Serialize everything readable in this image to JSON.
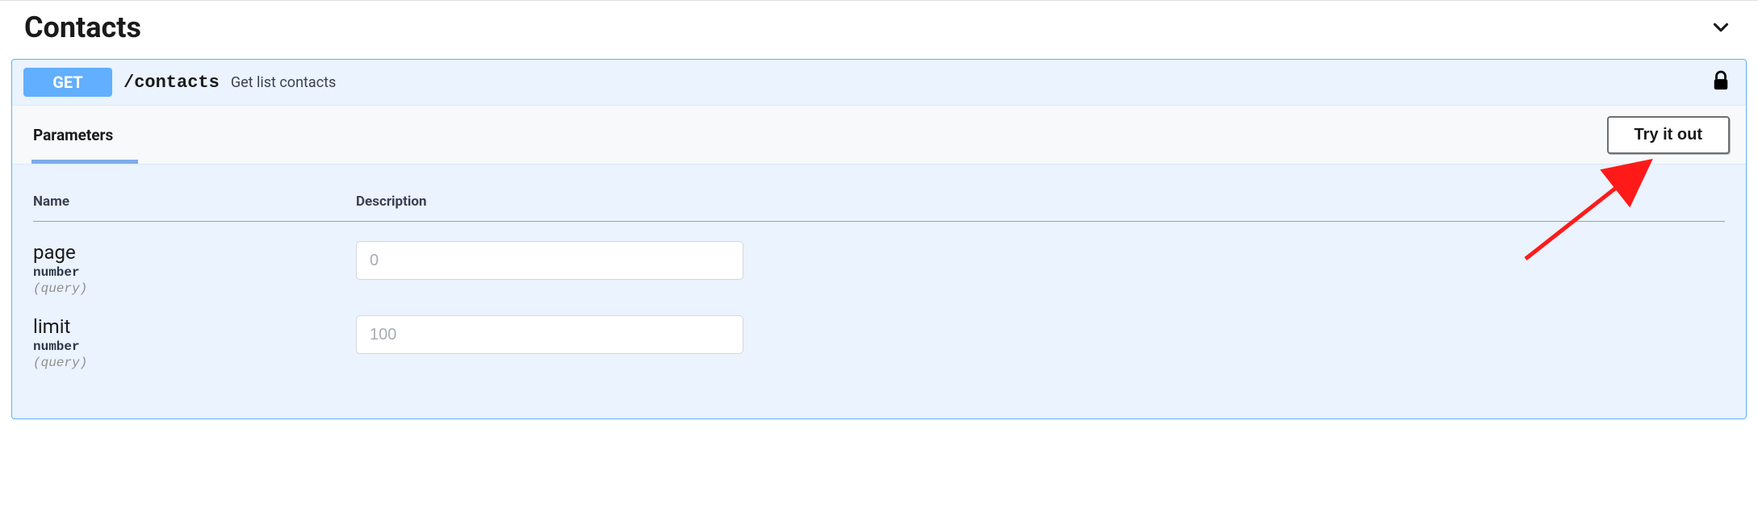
{
  "section": {
    "title": "Contacts"
  },
  "operation": {
    "method": "GET",
    "path": "/contacts",
    "description": "Get list contacts"
  },
  "tabs": {
    "parameters_label": "Parameters",
    "try_it_out_label": "Try it out"
  },
  "table": {
    "headers": {
      "name": "Name",
      "description": "Description"
    }
  },
  "parameters": [
    {
      "name": "page",
      "type": "number",
      "in": "(query)",
      "placeholder": "0"
    },
    {
      "name": "limit",
      "type": "number",
      "in": "(query)",
      "placeholder": "100"
    }
  ]
}
